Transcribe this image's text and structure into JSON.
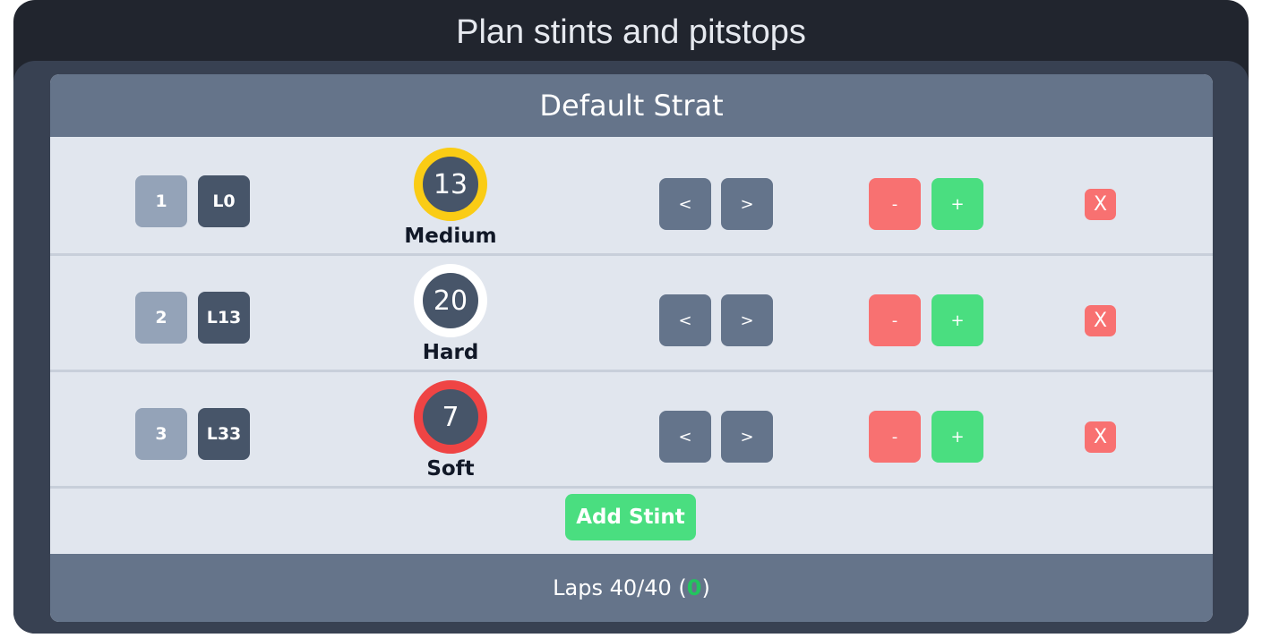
{
  "app_title": "Plan stints and pitstops",
  "strategy": {
    "name": "Default Strat",
    "stints": [
      {
        "index": "1",
        "start_lap": "L0",
        "tyre_life": "13",
        "compound": "Medium",
        "compound_color": "#facc15"
      },
      {
        "index": "2",
        "start_lap": "L13",
        "tyre_life": "20",
        "compound": "Hard",
        "compound_color": "#ffffff"
      },
      {
        "index": "3",
        "start_lap": "L33",
        "tyre_life": "7",
        "compound": "Soft",
        "compound_color": "#ef4444"
      }
    ],
    "controls": {
      "prev_label": "<",
      "next_label": ">",
      "minus_label": "-",
      "plus_label": "+",
      "delete_label": "X"
    },
    "add_stint_label": "Add Stint",
    "footer": {
      "prefix": "Laps 40/40 (",
      "difference": "0",
      "suffix": ")"
    }
  },
  "colors": {
    "background": "#21252e",
    "panel": "#384152",
    "header": "#65748a",
    "body": "#e1e6ee",
    "accent_green": "#4ade80",
    "accent_red": "#f87171"
  }
}
